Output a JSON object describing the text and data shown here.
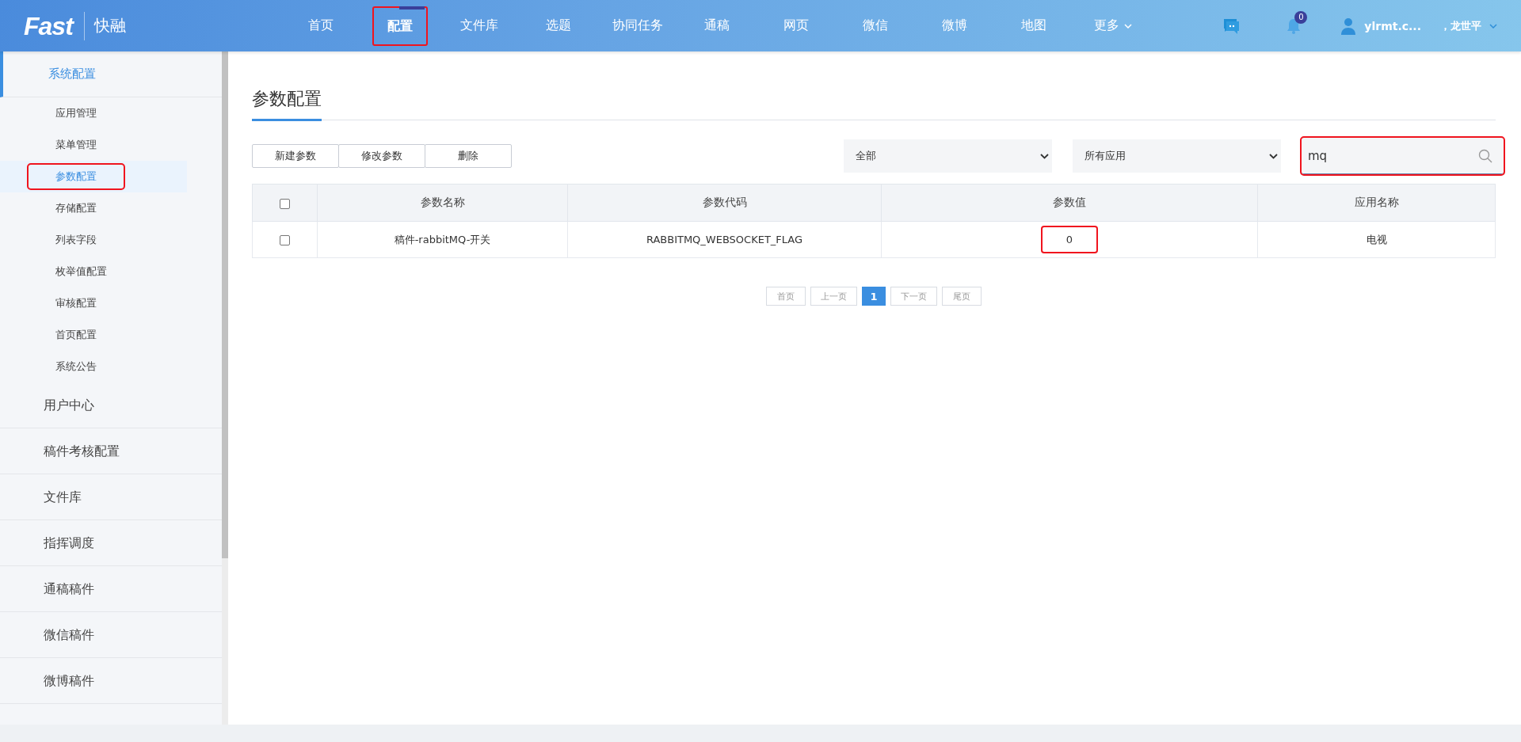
{
  "header": {
    "logo": "Fast",
    "brand": "快融",
    "nav": [
      {
        "label": "首页",
        "selected": false,
        "highlighted": false,
        "dropdown": false
      },
      {
        "label": "配置",
        "selected": true,
        "highlighted": true,
        "dropdown": false
      },
      {
        "label": "文件库",
        "selected": false,
        "highlighted": false,
        "dropdown": false
      },
      {
        "label": "选题",
        "selected": false,
        "highlighted": false,
        "dropdown": false
      },
      {
        "label": "协同任务",
        "selected": false,
        "highlighted": false,
        "dropdown": false
      },
      {
        "label": "通稿",
        "selected": false,
        "highlighted": false,
        "dropdown": false
      },
      {
        "label": "网页",
        "selected": false,
        "highlighted": false,
        "dropdown": false
      },
      {
        "label": "微信",
        "selected": false,
        "highlighted": false,
        "dropdown": false
      },
      {
        "label": "微博",
        "selected": false,
        "highlighted": false,
        "dropdown": false
      },
      {
        "label": "地图",
        "selected": false,
        "highlighted": false,
        "dropdown": false
      },
      {
        "label": "更多",
        "selected": false,
        "highlighted": false,
        "dropdown": true
      }
    ],
    "notification_count": "0",
    "user": "ylrmt.c...",
    "user_name": "，龙世平"
  },
  "sidebar": {
    "items": [
      {
        "label": "系统配置",
        "expanded": true,
        "children": [
          {
            "label": "应用管理",
            "selected": false,
            "highlighted": false
          },
          {
            "label": "菜单管理",
            "selected": false,
            "highlighted": false
          },
          {
            "label": "参数配置",
            "selected": true,
            "highlighted": true
          },
          {
            "label": "存储配置",
            "selected": false,
            "highlighted": false
          },
          {
            "label": "列表字段",
            "selected": false,
            "highlighted": false
          },
          {
            "label": "枚举值配置",
            "selected": false,
            "highlighted": false
          },
          {
            "label": "审核配置",
            "selected": false,
            "highlighted": false
          },
          {
            "label": "首页配置",
            "selected": false,
            "highlighted": false
          },
          {
            "label": "系统公告",
            "selected": false,
            "highlighted": false
          }
        ]
      },
      {
        "label": "用户中心",
        "expanded": false
      },
      {
        "label": "稿件考核配置",
        "expanded": false
      },
      {
        "label": "文件库",
        "expanded": false
      },
      {
        "label": "指挥调度",
        "expanded": false
      },
      {
        "label": "通稿稿件",
        "expanded": false
      },
      {
        "label": "微信稿件",
        "expanded": false
      },
      {
        "label": "微博稿件",
        "expanded": false
      }
    ]
  },
  "page": {
    "title": "参数配置",
    "buttons": [
      "新建参数",
      "修改参数",
      "删除"
    ],
    "filters": [
      "全部",
      "所有应用"
    ],
    "search": {
      "value": "mq",
      "highlighted": true
    },
    "table": {
      "all_checked": false,
      "columns": [
        "参数名称",
        "参数代码",
        "参数值",
        "应用名称"
      ],
      "rows": [
        {
          "checked": false,
          "cells": [
            {
              "text": "稿件-rabbitMQ-开关",
              "highlighted": false
            },
            {
              "text": "RABBITMQ_WEBSOCKET_FLAG",
              "highlighted": false
            },
            {
              "text": "0",
              "highlighted": true
            },
            {
              "text": "电视",
              "highlighted": false
            }
          ]
        }
      ]
    },
    "pagination": [
      {
        "label": "首页",
        "selected": false
      },
      {
        "label": "上一页",
        "selected": false
      },
      {
        "label": "1",
        "selected": true
      },
      {
        "label": "下一页",
        "selected": false
      },
      {
        "label": "尾页",
        "selected": false
      }
    ]
  }
}
